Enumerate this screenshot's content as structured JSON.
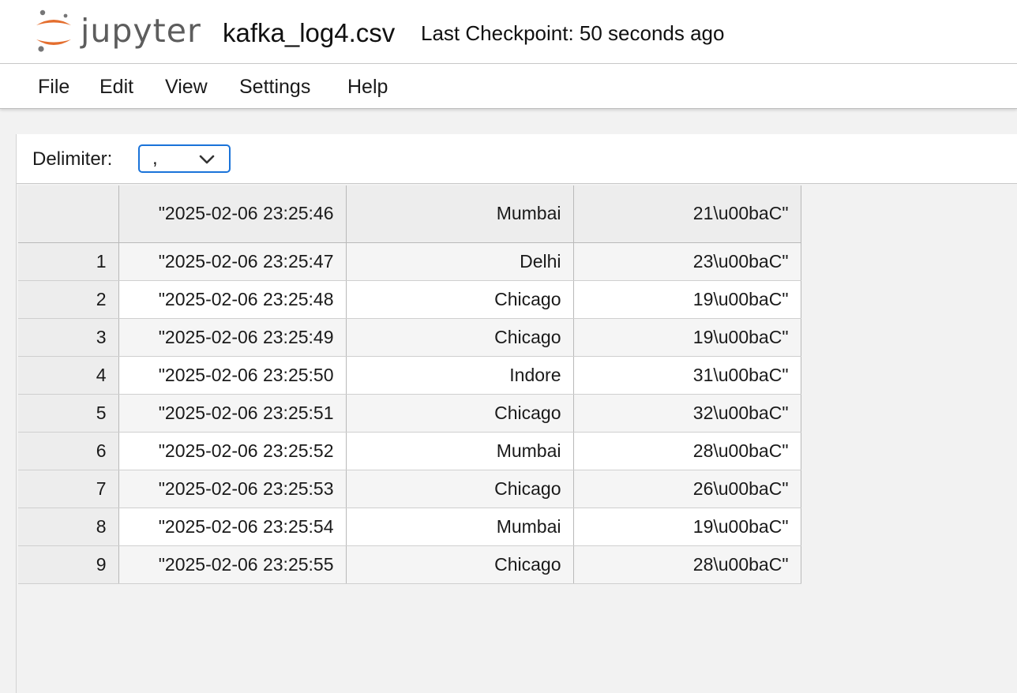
{
  "header": {
    "logo_text": "jupyter",
    "document_title": "kafka_log4.csv",
    "checkpoint_status": "Last Checkpoint: 50 seconds ago",
    "logo_colors": {
      "orange": "#e46e2e",
      "gray": "#767677"
    }
  },
  "menu": {
    "items": [
      {
        "label": "File"
      },
      {
        "label": "Edit"
      },
      {
        "label": "View"
      },
      {
        "label": "Settings"
      },
      {
        "label": "Help"
      }
    ]
  },
  "toolbar": {
    "delimiter_label": "Delimiter:",
    "delimiter_value": ",",
    "accent_color": "#1a73d9"
  },
  "grid": {
    "header": [
      "",
      "\"2025-02-06 23:25:46",
      "Mumbai",
      "21\\u00baC\""
    ],
    "rows": [
      [
        "1",
        "\"2025-02-06 23:25:47",
        "Delhi",
        "23\\u00baC\""
      ],
      [
        "2",
        "\"2025-02-06 23:25:48",
        "Chicago",
        "19\\u00baC\""
      ],
      [
        "3",
        "\"2025-02-06 23:25:49",
        "Chicago",
        "19\\u00baC\""
      ],
      [
        "4",
        "\"2025-02-06 23:25:50",
        "Indore",
        "31\\u00baC\""
      ],
      [
        "5",
        "\"2025-02-06 23:25:51",
        "Chicago",
        "32\\u00baC\""
      ],
      [
        "6",
        "\"2025-02-06 23:25:52",
        "Mumbai",
        "28\\u00baC\""
      ],
      [
        "7",
        "\"2025-02-06 23:25:53",
        "Chicago",
        "26\\u00baC\""
      ],
      [
        "8",
        "\"2025-02-06 23:25:54",
        "Mumbai",
        "19\\u00baC\""
      ],
      [
        "9",
        "\"2025-02-06 23:25:55",
        "Chicago",
        "28\\u00baC\""
      ]
    ]
  }
}
